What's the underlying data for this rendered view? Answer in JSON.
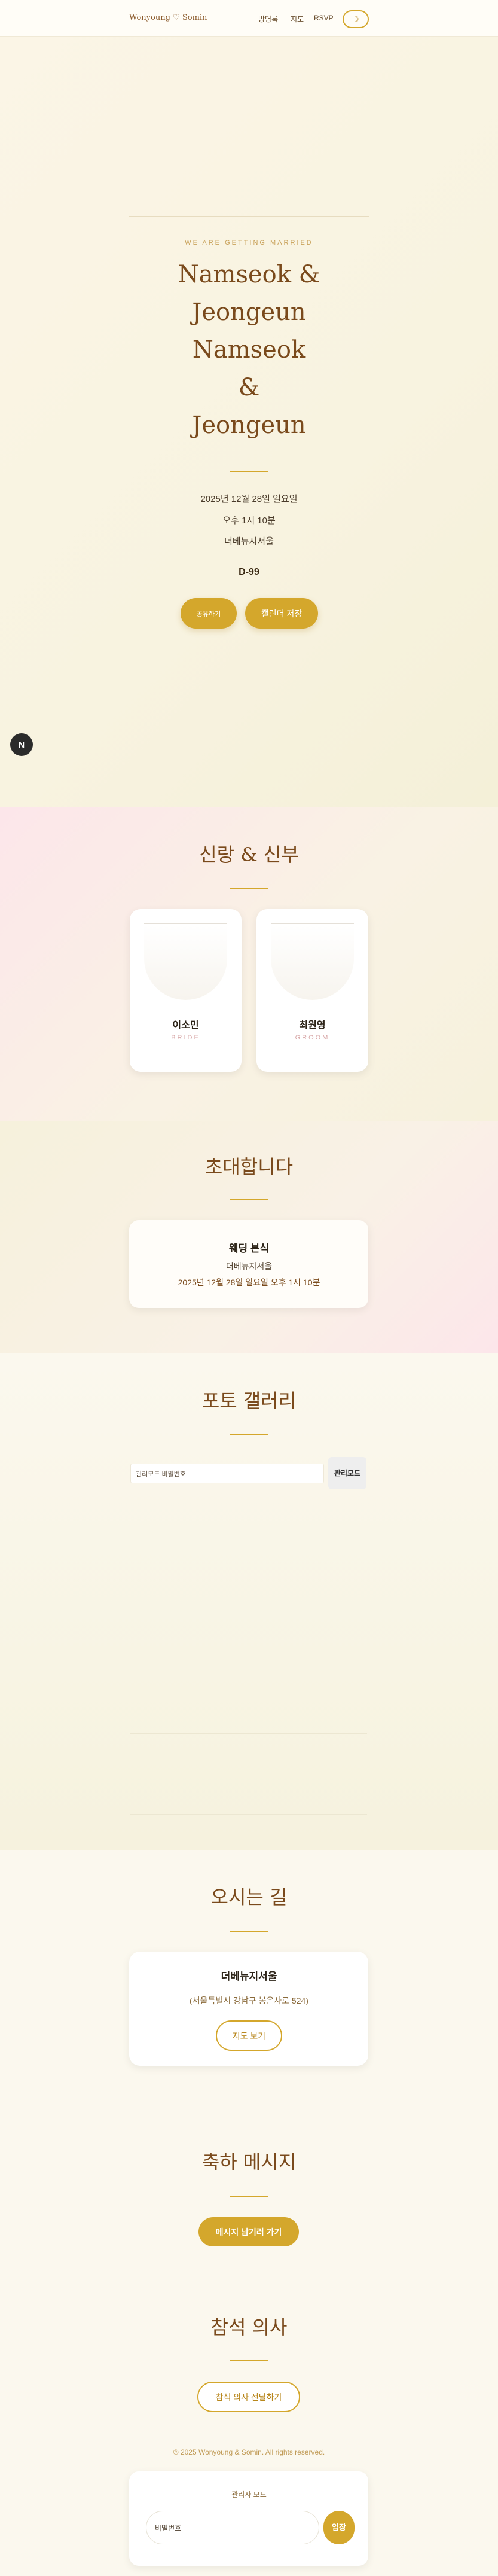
{
  "header": {
    "brand": "Wonyoung ♡ Somin",
    "nav": [
      "방명록",
      "지도",
      "RSVP"
    ],
    "theme_icon": "moon-icon"
  },
  "hero": {
    "eyebrow": "WE ARE GETTING MARRIED",
    "names": [
      "Namseok &",
      "Jeongeun",
      "Namseok",
      "&",
      "Jeongeun"
    ],
    "date": "2025년 12월 28일 일요일",
    "time": "오후 1시 10분",
    "venue": "더베뉴지서울",
    "dday": "D-99",
    "share_label": "공유하기",
    "calendar_label": "캘린더 저장",
    "music_button": "N"
  },
  "couple": {
    "title": "신랑 & 신부",
    "bride": {
      "name": "이소민",
      "role": "BRIDE"
    },
    "groom": {
      "name": "최원영",
      "role": "GROOM"
    }
  },
  "invitation": {
    "title": "초대합니다",
    "card_title": "웨딩 본식",
    "venue": "더베뉴지서울",
    "datetime": "2025년 12월 28일 일요일 오후 1시 10분"
  },
  "gallery": {
    "title": "포토 갤러리",
    "password_value": "관리모드 비밀번호",
    "admin_button": "관리모드"
  },
  "location": {
    "title": "오시는 길",
    "venue": "더베뉴지서울",
    "address": "(서울특별시 강남구 봉은사로 524)",
    "map_button": "지도 보기"
  },
  "message": {
    "title": "축하 메시지",
    "button": "메시지 남기러 가기"
  },
  "rsvp": {
    "title": "참석 의사",
    "button": "참석 의사 전달하기"
  },
  "footer": {
    "copyright": "© 2025 Wonyoung & Somin. All rights reserved.",
    "admin_title": "관리자 모드",
    "password_placeholder": "비밀번호",
    "login_button": "입장"
  },
  "colors": {
    "accent": "#d4a72c",
    "title_brown": "#7a4a1c",
    "blush": "#fce6ea",
    "cream": "#fbf8ee"
  }
}
